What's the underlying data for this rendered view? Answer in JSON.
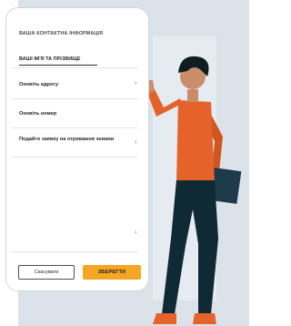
{
  "form": {
    "section_title": "ВАША КОНТАКТНА ІНФОРМАЦІЯ",
    "tab_label": "ВАШІ ІМ'Я ТА ПРІЗВИЩЕ",
    "items": [
      {
        "label": "Оновіть адресу"
      },
      {
        "label": "Оновіть номер"
      },
      {
        "label": "Подайте заявку на отримання знижки"
      }
    ],
    "cancel_label": "Скасувати",
    "save_label": "ЗБЕРЕГТИ"
  },
  "colors": {
    "accent": "#f5a623",
    "background_panel": "#dbe2ea",
    "shirt": "#e5622b",
    "pants": "#0f2a35"
  },
  "icons": [
    "chevron-right-icon"
  ]
}
